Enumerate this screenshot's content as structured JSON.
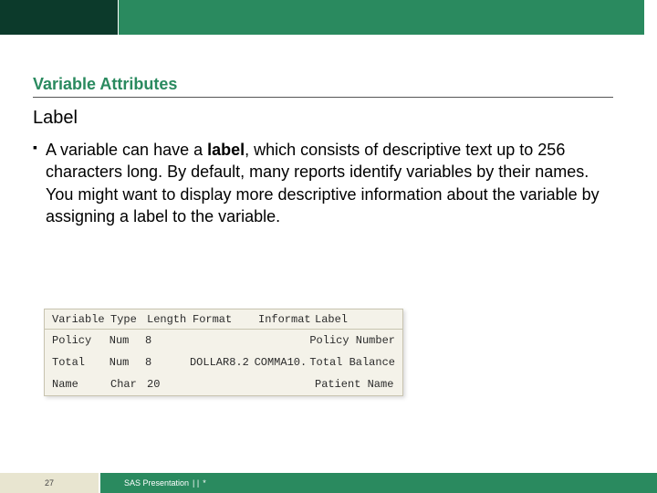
{
  "heading": "Variable Attributes",
  "subheading": "Label",
  "bullet": {
    "pre": "A variable can have a ",
    "emph": "label",
    "post": ", which consists of descriptive text up to 256 characters long. By default, many reports identify variables by their names. You might want to display more descriptive information about the variable by assigning a label to the variable."
  },
  "table": {
    "headers": {
      "variable": "Variable",
      "type": "Type",
      "length": "Length",
      "format": "Format",
      "informat": "Informat",
      "label": "Label"
    },
    "rows": [
      {
        "variable": "Policy",
        "type": "Num",
        "length": "8",
        "format": "",
        "informat": "",
        "label": "Policy Number"
      },
      {
        "variable": "Total",
        "type": "Num",
        "length": "8",
        "format": "DOLLAR8.2",
        "informat": "COMMA10.",
        "label": "Total Balance"
      },
      {
        "variable": "Name",
        "type": "Char",
        "length": "20",
        "format": "",
        "informat": "",
        "label": "Patient Name"
      }
    ]
  },
  "footer": {
    "page": "27",
    "text": "SAS Presentation",
    "sep": "| |",
    "star": "*"
  }
}
